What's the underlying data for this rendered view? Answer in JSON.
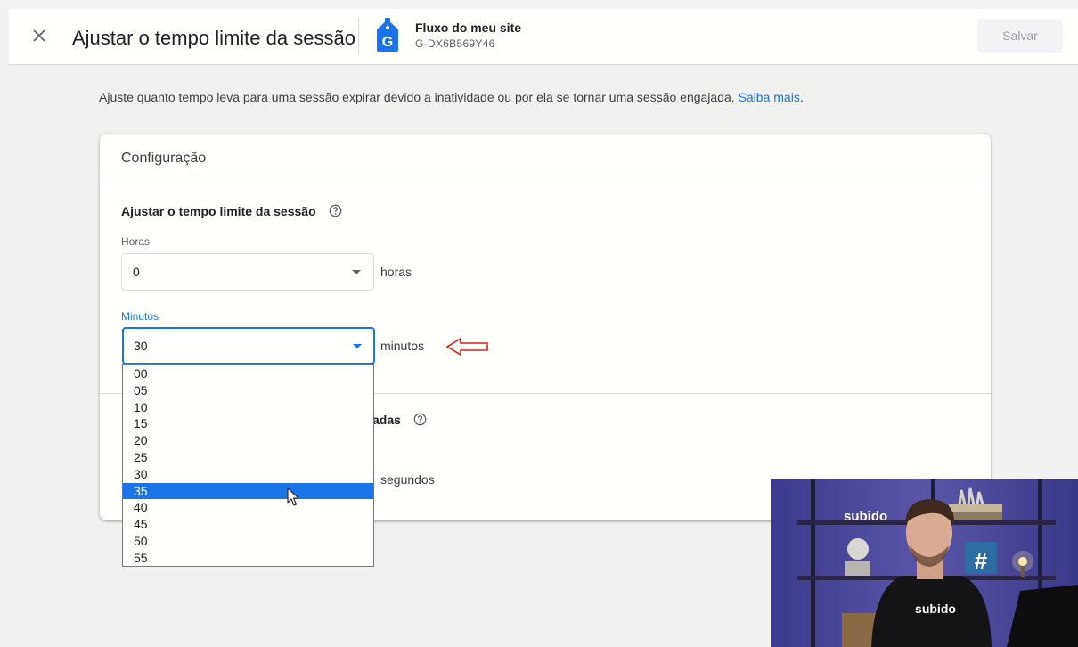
{
  "header": {
    "title": "Ajustar o tempo limite da sessão",
    "stream_name": "Fluxo do meu site",
    "stream_id": "G-DX6B569Y46",
    "save_label": "Salvar",
    "close_icon": "close-icon",
    "stream_icon": "tag-icon",
    "stream_icon_letter": "G"
  },
  "intro": {
    "text": "Ajuste quanto tempo leva para uma sessão expirar devido a inatividade ou por ela se tornar uma sessão engajada.",
    "link": "Saiba mais",
    "link_suffix": "."
  },
  "card": {
    "title": "Configuração",
    "session_timeout": {
      "title": "Ajustar o tempo limite da sessão",
      "hours_label": "Horas",
      "hours_value": "0",
      "hours_unit": "horas",
      "minutes_label": "Minutos",
      "minutes_value": "30",
      "minutes_unit": "minutos"
    },
    "engaged": {
      "title_visible": "adas",
      "unit": "segundos"
    }
  },
  "dropdown": {
    "options": [
      "00",
      "05",
      "10",
      "15",
      "20",
      "25",
      "30",
      "35",
      "40",
      "45",
      "50",
      "55"
    ],
    "highlighted_index": 7
  },
  "webcam": {
    "sign_text": "subido",
    "shirt_text": "subido",
    "poster_glyph": "#"
  },
  "colors": {
    "accent": "#1a73e8",
    "annotation_arrow": "#e02020",
    "background": "#f1f2f0"
  }
}
